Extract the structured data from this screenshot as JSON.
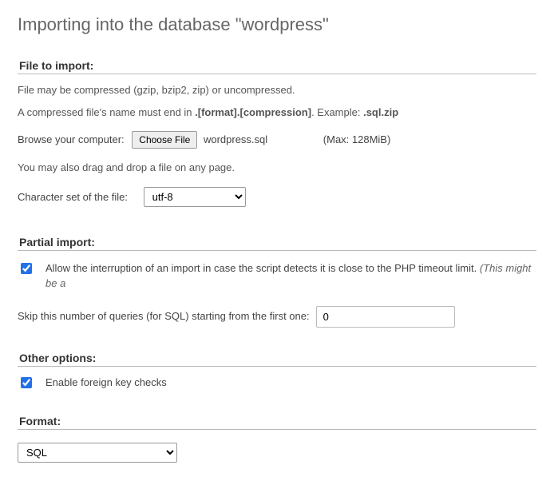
{
  "page_title": "Importing into the database \"wordpress\"",
  "file_section": {
    "legend": "File to import:",
    "hint1": "File may be compressed (gzip, bzip2, zip) or uncompressed.",
    "hint2_prefix": "A compressed file's name must end in ",
    "hint2_bold": ".[format].[compression]",
    "hint2_mid": ". Example: ",
    "hint2_example": ".sql.zip",
    "browse_label": "Browse your computer:",
    "choose_button": "Choose File",
    "chosen_file": "wordpress.sql",
    "max_label": "(Max: 128MiB)",
    "dragdrop": "You may also drag and drop a file on any page.",
    "charset_label": "Character set of the file:",
    "charset_value": "utf-8"
  },
  "partial_section": {
    "legend": "Partial import:",
    "allow_checked": true,
    "allow_text": "Allow the interruption of an import in case the script detects it is close to the PHP timeout limit.",
    "allow_note": "(This might be a",
    "skip_label": "Skip this number of queries (for SQL) starting from the first one:",
    "skip_value": "0"
  },
  "other_section": {
    "legend": "Other options:",
    "fk_checked": true,
    "fk_label": "Enable foreign key checks"
  },
  "format_section": {
    "legend": "Format:",
    "value": "SQL"
  }
}
